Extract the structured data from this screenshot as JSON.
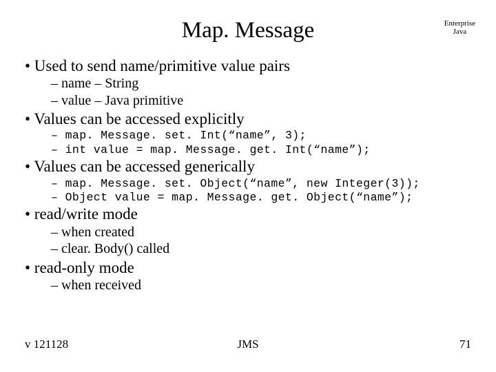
{
  "title": "Map. Message",
  "corner": {
    "line1": "Enterprise",
    "line2": "Java"
  },
  "bullets": {
    "b1": "•  Used to send name/primitive value pairs",
    "b1a": "– name – String",
    "b1b": "– value – Java primitive",
    "b2": "•  Values can be accessed explicitly",
    "b2a": "– map. Message. set. Int(“name”, 3);",
    "b2b": "– int value = map. Message. get. Int(“name”);",
    "b3": "•  Values can be accessed generically",
    "b3a": "– map. Message. set. Object(“name”, new Integer(3));",
    "b3b": "– Object value = map. Message. get. Object(“name”);",
    "b4": "•  read/write mode",
    "b4a": "– when created",
    "b4b": "– clear. Body() called",
    "b5": "•  read-only mode",
    "b5a": "– when received"
  },
  "footer": {
    "left": "v 121128",
    "center": "JMS",
    "right": "71"
  }
}
